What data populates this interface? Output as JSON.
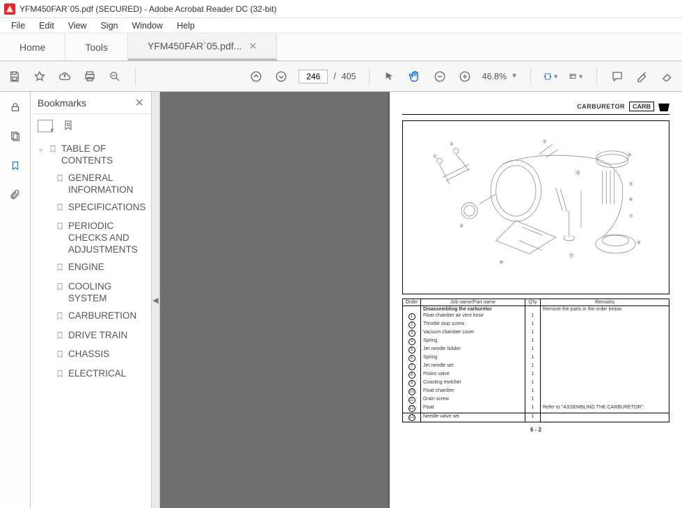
{
  "window": {
    "title": "YFM450FAR`05.pdf (SECURED) - Adobe Acrobat Reader DC (32-bit)"
  },
  "menus": [
    "File",
    "Edit",
    "View",
    "Sign",
    "Window",
    "Help"
  ],
  "tabs": {
    "home": "Home",
    "tools": "Tools",
    "doc": "YFM450FAR`05.pdf..."
  },
  "page_nav": {
    "current": "246",
    "sep": "/",
    "total": "405"
  },
  "zoom": {
    "value": "46.8%"
  },
  "panel": {
    "title": "Bookmarks"
  },
  "bookmarks": {
    "root": "TABLE OF CONTENTS",
    "items": [
      "GENERAL INFORMATION",
      "SPECIFICATIONS",
      "PERIODIC CHECKS AND ADJUSTMENTS",
      "ENGINE",
      "COOLING SYSTEM",
      "CARBURETION",
      "DRIVE TRAIN",
      "CHASSIS",
      "ELECTRICAL"
    ]
  },
  "doc": {
    "header_label": "CARBURETOR",
    "header_box": "CARB",
    "table": {
      "headers": {
        "order": "Order",
        "name": "Job name/Part name",
        "qty": "Q'ty",
        "remarks": "Remarks"
      },
      "title_row": {
        "name": "Disassembling the carburetor",
        "remarks": "Remove the parts in the order below."
      },
      "rows": [
        {
          "order": "1",
          "name": "Float chamber air vent hose",
          "qty": "1"
        },
        {
          "order": "2",
          "name": "Throttle stop screw",
          "qty": "1"
        },
        {
          "order": "3",
          "name": "Vacuum chamber cover",
          "qty": "1"
        },
        {
          "order": "4",
          "name": "Spring",
          "qty": "1"
        },
        {
          "order": "5",
          "name": "Jet needle holder",
          "qty": "1"
        },
        {
          "order": "6",
          "name": "Spring",
          "qty": "1"
        },
        {
          "order": "7",
          "name": "Jet needle set",
          "qty": "1"
        },
        {
          "order": "8",
          "name": "Piston valve",
          "qty": "1"
        },
        {
          "order": "9",
          "name": "Coasting enricher",
          "qty": "1"
        },
        {
          "order": "10",
          "name": "Float chamber",
          "qty": "1"
        },
        {
          "order": "11",
          "name": "Drain screw",
          "qty": "1"
        },
        {
          "order": "12",
          "name": "Float",
          "qty": "1",
          "remarks": "Refer to \"ASSEMBLING THE CARBURETOR\"."
        },
        {
          "order": "13",
          "name": "Needle valve set",
          "qty": "1"
        }
      ]
    },
    "page_number": "6 - 2"
  }
}
